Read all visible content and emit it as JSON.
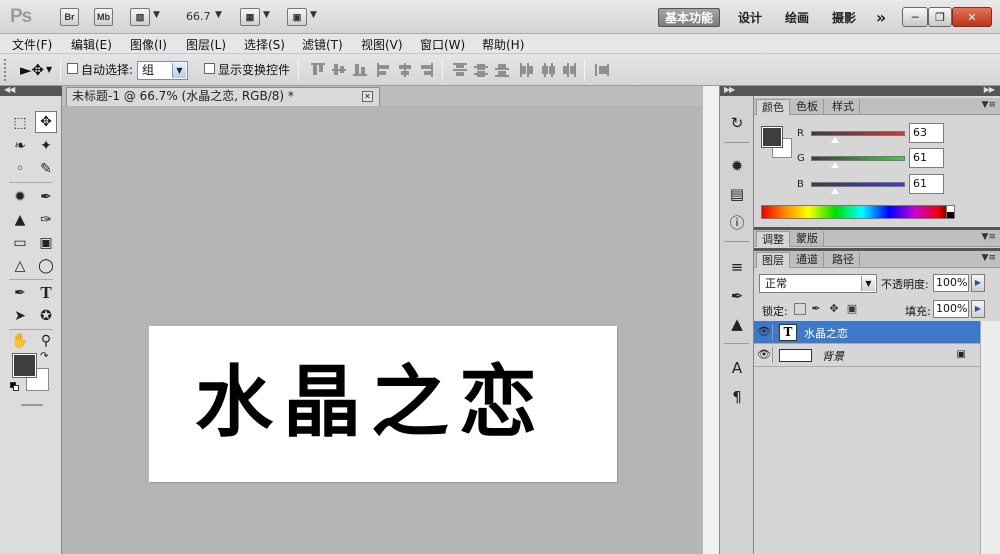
{
  "app": {
    "logo": "Ps",
    "bridge_label": "Br",
    "minibridge_label": "Mb",
    "zoom": "66.7",
    "workspaces": [
      {
        "label": "基本功能",
        "active": true
      },
      {
        "label": "设计",
        "active": false
      },
      {
        "label": "绘画",
        "active": false
      },
      {
        "label": "摄影",
        "active": false
      }
    ],
    "more_workspaces": "»"
  },
  "menu": [
    "文件(F)",
    "编辑(E)",
    "图像(I)",
    "图层(L)",
    "选择(S)",
    "滤镜(T)",
    "视图(V)",
    "窗口(W)",
    "帮助(H)"
  ],
  "options": {
    "auto_select_label": "自动选择:",
    "auto_select_value": "组",
    "show_transform_label": "显示变换控件"
  },
  "document": {
    "tab_title": "未标题-1 @ 66.7% (水晶之恋, RGB/8) *",
    "canvas_text": "水晶之恋"
  },
  "color_panel": {
    "tabs": [
      "颜色",
      "色板",
      "样式"
    ],
    "channels": [
      {
        "name": "R",
        "value": "63"
      },
      {
        "name": "G",
        "value": "61"
      },
      {
        "name": "B",
        "value": "61"
      }
    ]
  },
  "adjust_panel": {
    "tabs": [
      "调整",
      "蒙版"
    ]
  },
  "layers_panel": {
    "tabs": [
      "图层",
      "通道",
      "路径"
    ],
    "blend_mode": "正常",
    "opacity_label": "不透明度:",
    "opacity_value": "100%",
    "lock_label": "锁定:",
    "fill_label": "填充:",
    "fill_value": "100%",
    "layers": [
      {
        "name": "水晶之恋",
        "thumb": "T",
        "selected": true
      },
      {
        "name": "背景",
        "selected": false,
        "locked": true
      }
    ]
  },
  "colors": {
    "foreground": "#3f3d3d",
    "background": "#ffffff",
    "selection": "#3e78c8"
  }
}
